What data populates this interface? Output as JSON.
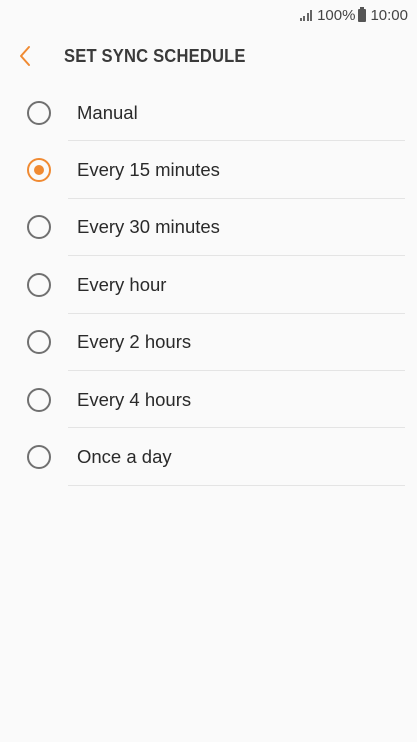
{
  "status_bar": {
    "battery_text": "100%",
    "time": "10:00",
    "signal_icon": "signal-icon",
    "battery_icon": "battery-icon"
  },
  "header": {
    "back_icon": "chevron-left-icon",
    "title": "SET SYNC SCHEDULE"
  },
  "colors": {
    "accent": "#f08a32",
    "radio_unchecked": "#707070",
    "background": "#fafafa",
    "divider": "#e4e4e4"
  },
  "options": [
    {
      "label": "Manual",
      "selected": false
    },
    {
      "label": "Every 15 minutes",
      "selected": true
    },
    {
      "label": "Every 30 minutes",
      "selected": false
    },
    {
      "label": "Every hour",
      "selected": false
    },
    {
      "label": "Every 2 hours",
      "selected": false
    },
    {
      "label": "Every 4 hours",
      "selected": false
    },
    {
      "label": "Once a day",
      "selected": false
    }
  ]
}
